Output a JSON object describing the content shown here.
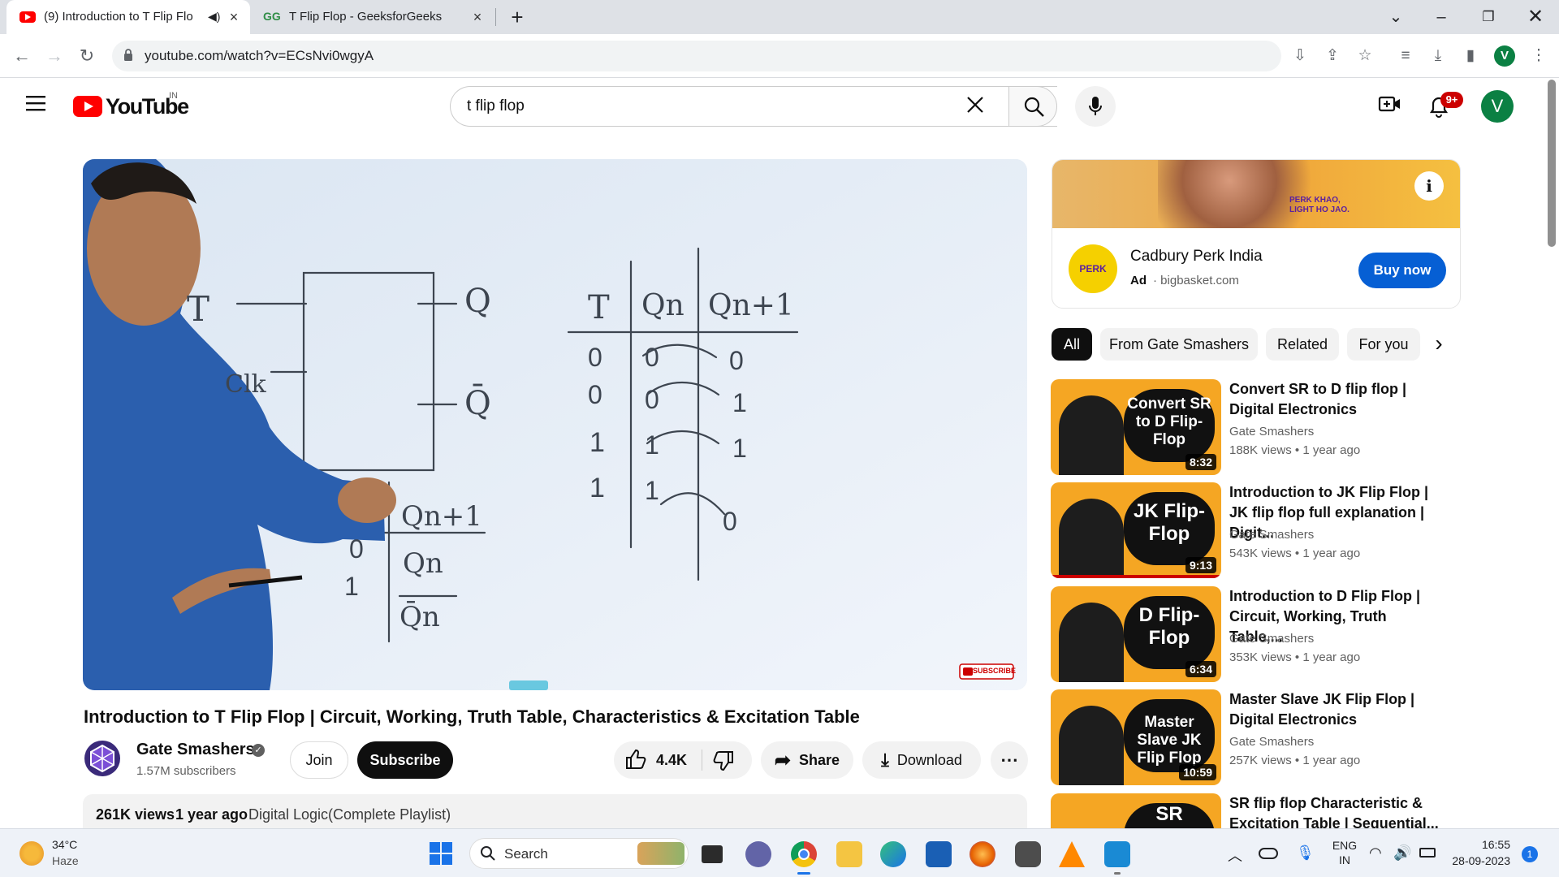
{
  "browser": {
    "tabs": [
      {
        "title": "(9) Introduction to T Flip Flo",
        "active": true
      },
      {
        "title": "T Flip Flop - GeeksforGeeks",
        "active": false
      }
    ],
    "new_tab": "+",
    "url": "youtube.com/watch?v=ECsNvi0wgyA",
    "profile_initial": "V"
  },
  "youtube": {
    "logo_text": "YouTube",
    "region": "IN",
    "search_value": "t flip flop",
    "notifications_badge": "9+",
    "avatar_initial": "V"
  },
  "video": {
    "title": "Introduction to T Flip Flop | Circuit, Working, Truth Table, Characteristics & Excitation Table",
    "channel": "Gate Smashers",
    "subscribers": "1.57M subscribers",
    "join_label": "Join",
    "subscribe_label": "Subscribe",
    "likes": "4.4K",
    "share_label": "Share",
    "download_label": "Download",
    "views": "261K views",
    "age": "1 year ago",
    "playlist": "Digital Logic(Complete Playlist)",
    "watermark": "SUBSCRIBE",
    "board": {
      "t": "T",
      "clk": "Clk",
      "q": "Q",
      "qbar": "Q̄",
      "h_t": "T",
      "h_qn": "Qn",
      "h_qn1": "Qn+1",
      "r_qn": [
        "0",
        "0",
        "1",
        "1"
      ],
      "r_qn1": [
        "0",
        "1",
        "1",
        "0"
      ],
      "s_qn1": "Qn+1",
      "s0": "0",
      "s1": "1",
      "s_qn": "Qn",
      "s_qnbar": "Q̄n"
    }
  },
  "ad": {
    "brand": "Cadbury Perk India",
    "ad_label": "Ad",
    "source": "bigbasket.com",
    "cta": "Buy now",
    "banner_text": "PERK KHAO, LIGHT HO JAO."
  },
  "chips": [
    "All",
    "From Gate Smashers",
    "Related",
    "For you"
  ],
  "recommendations": [
    {
      "title": "Convert SR to D flip flop | Digital Electronics",
      "channel": "Gate Smashers",
      "views": "188K views",
      "age": "1 year ago",
      "duration": "8:32",
      "thumb_text": "Convert SR to D Flip-Flop"
    },
    {
      "title": "Introduction to JK Flip Flop | JK flip flop full explanation | Digit...",
      "channel": "Gate Smashers",
      "views": "543K views",
      "age": "1 year ago",
      "duration": "9:13",
      "thumb_text": "JK Flip-Flop"
    },
    {
      "title": "Introduction to D Flip Flop | Circuit, Working, Truth Table,...",
      "channel": "Gate Smashers",
      "views": "353K views",
      "age": "1 year ago",
      "duration": "6:34",
      "thumb_text": "D Flip-Flop"
    },
    {
      "title": "Master Slave JK Flip Flop | Digital Electronics",
      "channel": "Gate Smashers",
      "views": "257K views",
      "age": "1 year ago",
      "duration": "10:59",
      "thumb_text": "Master Slave JK Flip Flop"
    },
    {
      "title": "SR flip flop Characteristic & Excitation Table | Sequential...",
      "channel": "",
      "views": "",
      "age": "",
      "duration": "",
      "thumb_text": "SR"
    }
  ],
  "taskbar": {
    "temperature": "34°C",
    "weather": "Haze",
    "search_placeholder": "Search",
    "lang": "ENG",
    "lang_region": "IN",
    "time": "16:55",
    "date": "28-09-2023",
    "notif_count": "1"
  },
  "colors": {
    "yt_red": "#ff0000",
    "subscribe_bg": "#0f0f0f",
    "buy_now": "#065fd4",
    "avatar": "#0b8043",
    "thumb": "#f5a623"
  }
}
